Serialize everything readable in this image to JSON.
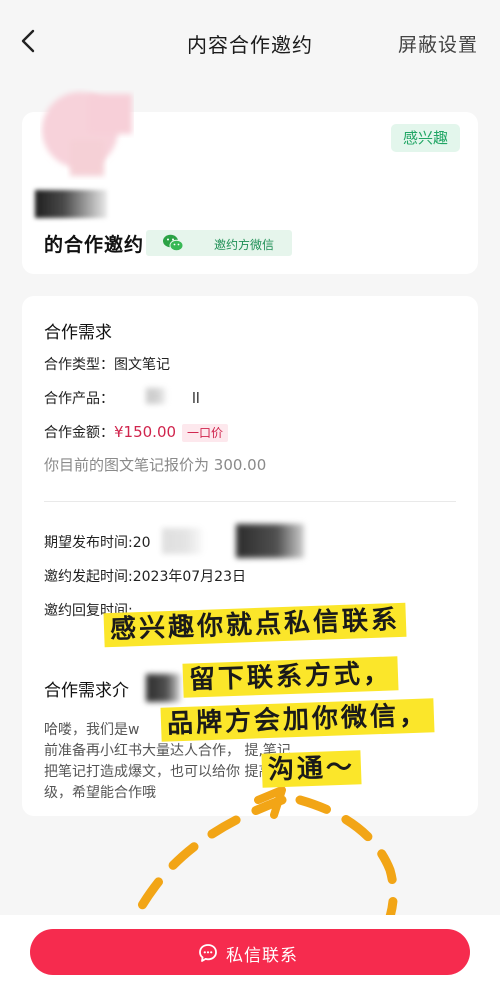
{
  "header": {
    "title": "内容合作邀约",
    "right_action": "屏蔽设置"
  },
  "invite_card": {
    "status_tag": "感兴趣",
    "invite_text": "的合作邀约",
    "wechat_label": "邀约方微信"
  },
  "requirements": {
    "section_title": "合作需求",
    "type_key": "合作类型：",
    "type_value": "图文笔记",
    "product_key": "合作产品：",
    "product_value": "ll",
    "amount_key": "合作金额：",
    "amount_value": "¥150.00",
    "price_tag": "一口价",
    "quote_hint": "你目前的图文笔记报价为 300.00",
    "publish_key": "期望发布时间:",
    "publish_value": "20",
    "start_key": "邀约发起时间:",
    "start_value": "2023年07月23日",
    "reply_key": "邀约回复时间:",
    "intro_title": "合作需求介",
    "intro_line1": "哈喽，我们是w",
    "intro_line2": "前准备再小红书大量达人合作，                   提,笔记,",
    "intro_line3": "把笔记打造成爆文，也可以给你                提高账号等",
    "intro_line4": "级，希望能合作哦"
  },
  "annotation": {
    "line1": "感兴趣你就点私信联系",
    "line2": "留下联系方式，",
    "line3": "品牌方会加你微信，",
    "line4": "沟通～"
  },
  "footer": {
    "dm_button": "私信联系"
  },
  "colors": {
    "accent": "#f62b4e",
    "interest_green": "#21a665",
    "amount_red": "#d0254d",
    "highlight_yellow": "#fbe62a",
    "arrow_orange": "#f2a516"
  }
}
